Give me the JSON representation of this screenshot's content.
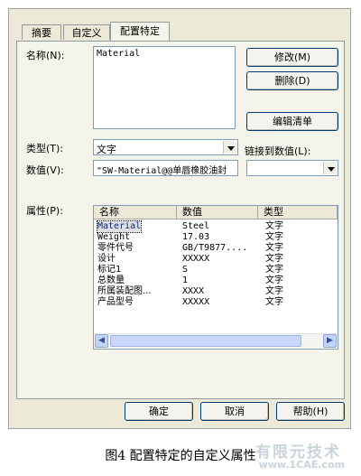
{
  "tabs": [
    {
      "label": "摘要"
    },
    {
      "label": "自定义"
    },
    {
      "label": "配置特定"
    }
  ],
  "name_label": "名称(N):",
  "name_value": "Material",
  "buttons": {
    "modify": "修改(M)",
    "delete": "删除(D)",
    "edit_list": "编辑清单",
    "ok": "确定",
    "cancel": "取消",
    "help": "帮助(H)"
  },
  "type_label": "类型(T):",
  "type_value": "文字",
  "link_label": "链接到数值(L):",
  "link_value": "",
  "value_label": "数值(V):",
  "value_value": "\"SW-Material@@单唇橡胶油封",
  "props_label": "属性(P):",
  "list": {
    "columns": [
      "名称",
      "数值",
      "类型"
    ],
    "rows": [
      {
        "name": "Material",
        "value": "Steel",
        "type": "文字"
      },
      {
        "name": "Weight",
        "value": "17.03",
        "type": "文字"
      },
      {
        "name": "零件代号",
        "value": "GB/T9877....",
        "type": "文字"
      },
      {
        "name": "设计",
        "value": "XXXXX",
        "type": "文字"
      },
      {
        "name": "标记1",
        "value": "S",
        "type": "文字"
      },
      {
        "name": "总数量",
        "value": "1",
        "type": "文字"
      },
      {
        "name": "所属装配图...",
        "value": "XXXX",
        "type": "文字"
      },
      {
        "name": "产品型号",
        "value": "XXXXX",
        "type": "文字"
      }
    ]
  },
  "caption": "图4  配置特定的自定义属性",
  "watermark": {
    "line1": "有限元技术",
    "line2": "www.1CAE.com"
  }
}
